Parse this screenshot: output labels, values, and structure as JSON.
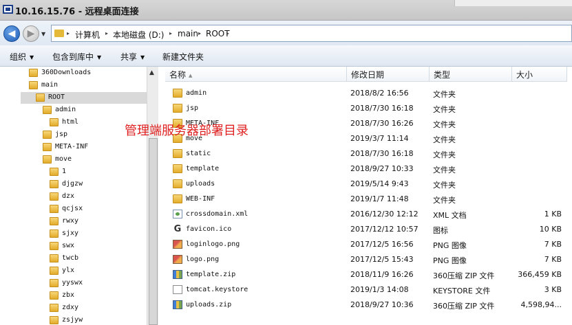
{
  "window": {
    "title": "10.16.15.76 - 远程桌面连接"
  },
  "address_bar": {
    "crumbs": [
      "计算机",
      "本地磁盘 (D:)",
      "main",
      "ROOT"
    ]
  },
  "toolbar": {
    "organize": "组织",
    "include_in_library": "包含到库中",
    "share": "共享",
    "new_folder": "新建文件夹"
  },
  "tree": {
    "items": [
      {
        "label": "360Downloads",
        "level": 1
      },
      {
        "label": "main",
        "level": 1
      },
      {
        "label": "ROOT",
        "level": 2,
        "selected": true
      },
      {
        "label": "admin",
        "level": 3
      },
      {
        "label": "html",
        "level": 4
      },
      {
        "label": "jsp",
        "level": 3
      },
      {
        "label": "META-INF",
        "level": 3
      },
      {
        "label": "move",
        "level": 3
      },
      {
        "label": "1",
        "level": 4
      },
      {
        "label": "djgzw",
        "level": 4
      },
      {
        "label": "dzx",
        "level": 4
      },
      {
        "label": "qcjsx",
        "level": 4
      },
      {
        "label": "rwxy",
        "level": 4
      },
      {
        "label": "sjxy",
        "level": 4
      },
      {
        "label": "swx",
        "level": 4
      },
      {
        "label": "twcb",
        "level": 4
      },
      {
        "label": "ylx",
        "level": 4
      },
      {
        "label": "yyswx",
        "level": 4
      },
      {
        "label": "zbx",
        "level": 4
      },
      {
        "label": "zdxy",
        "level": 4
      },
      {
        "label": "zsjyw",
        "level": 4
      }
    ]
  },
  "columns": {
    "name": "名称",
    "modified": "修改日期",
    "type": "类型",
    "size": "大小"
  },
  "files": [
    {
      "name": "admin",
      "modified": "2018/8/2 16:56",
      "type": "文件夹",
      "size": "",
      "icon": "folder-icon"
    },
    {
      "name": "jsp",
      "modified": "2018/7/30 16:18",
      "type": "文件夹",
      "size": "",
      "icon": "folder-icon"
    },
    {
      "name": "META-INF",
      "modified": "2018/7/30 16:26",
      "type": "文件夹",
      "size": "",
      "icon": "folder-icon"
    },
    {
      "name": "move",
      "modified": "2019/3/7 11:14",
      "type": "文件夹",
      "size": "",
      "icon": "folder-icon"
    },
    {
      "name": "static",
      "modified": "2018/7/30 16:18",
      "type": "文件夹",
      "size": "",
      "icon": "folder-icon"
    },
    {
      "name": "template",
      "modified": "2018/9/27 10:33",
      "type": "文件夹",
      "size": "",
      "icon": "folder-icon"
    },
    {
      "name": "uploads",
      "modified": "2019/5/14 9:43",
      "type": "文件夹",
      "size": "",
      "icon": "folder-icon"
    },
    {
      "name": "WEB-INF",
      "modified": "2019/1/7 11:48",
      "type": "文件夹",
      "size": "",
      "icon": "folder-icon"
    },
    {
      "name": "crossdomain.xml",
      "modified": "2016/12/30 12:12",
      "type": "XML 文档",
      "size": "1 KB",
      "icon": "xml-file-icon"
    },
    {
      "name": "favicon.ico",
      "modified": "2017/12/12 10:57",
      "type": "图标",
      "size": "10 KB",
      "icon": "favicon-file-icon"
    },
    {
      "name": "loginlogo.png",
      "modified": "2017/12/5 16:56",
      "type": "PNG 图像",
      "size": "7 KB",
      "icon": "png-file-icon"
    },
    {
      "name": "logo.png",
      "modified": "2017/12/5 15:43",
      "type": "PNG 图像",
      "size": "7 KB",
      "icon": "png-file-icon"
    },
    {
      "name": "template.zip",
      "modified": "2018/11/9 16:26",
      "type": "360压缩 ZIP 文件",
      "size": "366,459 KB",
      "icon": "zip-file-icon"
    },
    {
      "name": "tomcat.keystore",
      "modified": "2019/1/3 14:08",
      "type": "KEYSTORE 文件",
      "size": "3 KB",
      "icon": "blank-file-icon"
    },
    {
      "name": "uploads.zip",
      "modified": "2018/9/27 10:36",
      "type": "360压缩 ZIP 文件",
      "size": "4,598,94...",
      "icon": "zip-file-icon"
    }
  ],
  "annotation": {
    "text": "管理端服务器部署目录",
    "color": "#e02020"
  }
}
